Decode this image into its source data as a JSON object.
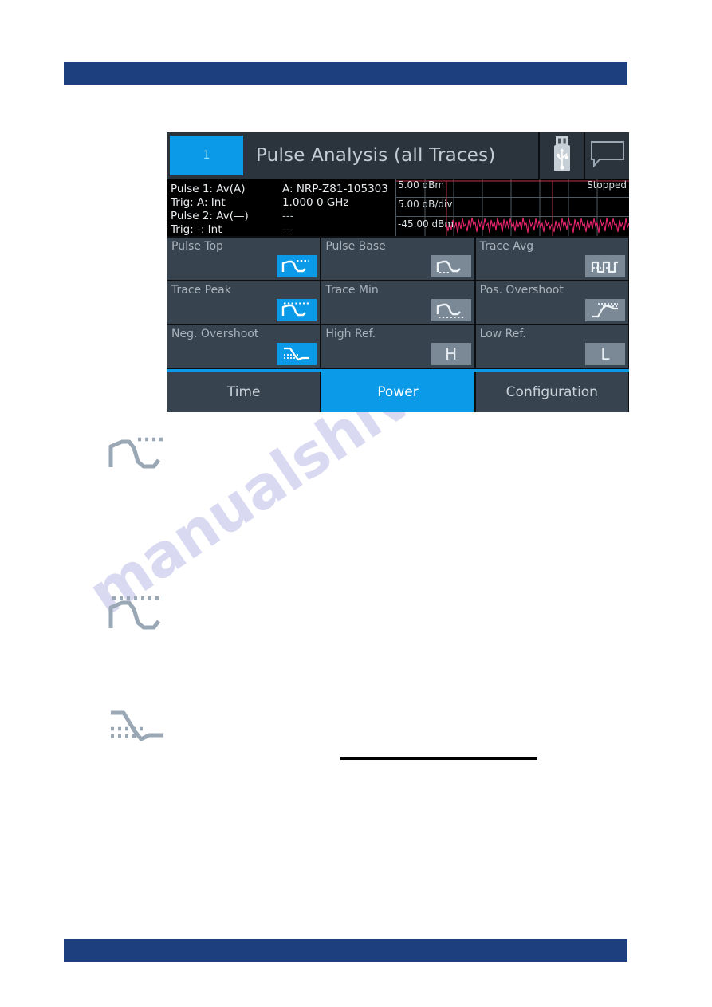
{
  "page": {
    "bar_color": "#1d3f7e",
    "watermark_text": "manualshive.com"
  },
  "device": {
    "header": {
      "channel_badge": "1",
      "title": "Pulse Analysis (all Traces)",
      "icons": [
        {
          "name": "usb-stick-icon",
          "label": "usb-stick-icon"
        },
        {
          "name": "speech-bubble-icon",
          "label": "speech-bubble-icon"
        }
      ]
    },
    "info": {
      "rows": [
        {
          "label": "Pulse 1: Av(A)",
          "value": "A: NRP-Z81-105303"
        },
        {
          "label": "Trig: A: Int",
          "value": "1.000 0 GHz"
        },
        {
          "label": "Pulse 2: Av(—)",
          "value": "---"
        },
        {
          "label": "Trig: -: Int",
          "value": "---"
        }
      ]
    },
    "trace": {
      "top_label": "5.00 dBm",
      "div_label": "5.00 dB/div",
      "bottom_label": "-45.00 dBm",
      "status": "Stopped",
      "trace_color": "#e8256e",
      "grid_color": "#4f5a63",
      "marker_color": "#c4324f"
    },
    "buttons": [
      [
        {
          "label": "Pulse Top",
          "icon": "pulse-top-icon",
          "active": true,
          "glyph": ""
        },
        {
          "label": "Pulse Base",
          "icon": "pulse-base-icon",
          "active": false,
          "glyph": ""
        },
        {
          "label": "Trace Avg",
          "icon": "trace-avg-icon",
          "active": false,
          "glyph": ""
        }
      ],
      [
        {
          "label": "Trace Peak",
          "icon": "trace-peak-icon",
          "active": true,
          "glyph": ""
        },
        {
          "label": "Trace Min",
          "icon": "trace-min-icon",
          "active": false,
          "glyph": ""
        },
        {
          "label": "Pos. Overshoot",
          "icon": "pos-overshoot-icon",
          "active": false,
          "glyph": ""
        }
      ],
      [
        {
          "label": "Neg. Overshoot",
          "icon": "neg-overshoot-icon",
          "active": true,
          "glyph": ""
        },
        {
          "label": "High Ref.",
          "icon": "high-ref-icon",
          "active": false,
          "glyph": "H"
        },
        {
          "label": "Low Ref.",
          "icon": "low-ref-icon",
          "active": false,
          "glyph": "L"
        }
      ]
    ],
    "tabs": [
      {
        "label": "Time",
        "active": false
      },
      {
        "label": "Power",
        "active": true
      },
      {
        "label": "Configuration",
        "active": false
      }
    ],
    "colors": {
      "accent": "#0b9ae8",
      "button_bg": "#37434f",
      "header_bg": "#2b333c",
      "icon_bg": "#7b8997"
    }
  },
  "doc_icons": [
    {
      "name": "pulse-top-icon"
    },
    {
      "name": "trace-peak-icon"
    },
    {
      "name": "neg-overshoot-icon"
    }
  ]
}
